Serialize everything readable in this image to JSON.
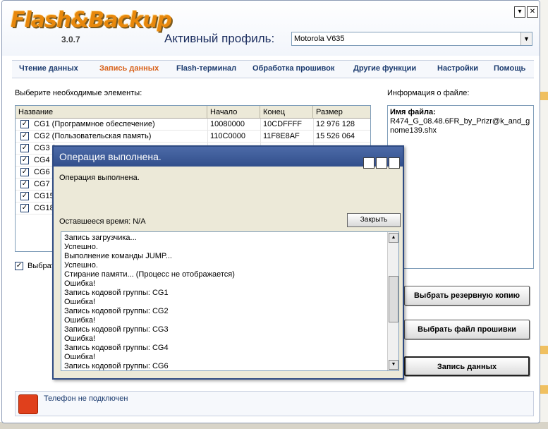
{
  "app": {
    "logo": "Flash&Backup",
    "version": "3.0.7",
    "profile_label": "Активный профиль:",
    "profile_value": "Motorola V635"
  },
  "tabs": [
    {
      "label": "Чтение данных"
    },
    {
      "label": "Запись данных"
    },
    {
      "label": "Flash-терминал"
    },
    {
      "label": "Обработка прошивок"
    },
    {
      "label": "Другие функции"
    },
    {
      "label": "Настройки"
    },
    {
      "label": "Помощь"
    }
  ],
  "select_label": "Выберите необходимые элементы:",
  "info_label": "Информация о файле:",
  "table": {
    "headers": [
      "Название",
      "Начало",
      "Конец",
      "Размер"
    ],
    "rows": [
      {
        "name": "CG1 (Программное обеспечение)",
        "start": "10080000",
        "end": "10CDFFFF",
        "size": "12 976 128"
      },
      {
        "name": "CG2 (Пользовательская память)",
        "start": "110C0000",
        "end": "11F8E8AF",
        "size": "15 526 064"
      },
      {
        "name": "CG3 (",
        "start": "",
        "end": "",
        "size": ""
      },
      {
        "name": "CG4 (",
        "start": "",
        "end": "",
        "size": ""
      },
      {
        "name": "CG6 (",
        "start": "",
        "end": "",
        "size": ""
      },
      {
        "name": "CG7 (",
        "start": "",
        "end": "",
        "size": ""
      },
      {
        "name": "CG15",
        "start": "",
        "end": "",
        "size": ""
      },
      {
        "name": "CG18",
        "start": "",
        "end": "",
        "size": ""
      }
    ]
  },
  "select_all": "Выбрат",
  "file_info": {
    "name_label": "Имя файла:",
    "name_value": "R474_G_08.48.6FR_by_Prizr@k_and_gnome139.shx"
  },
  "buttons": {
    "backup": "Выбрать резервную копию",
    "firmware": "Выбрать файл прошивки",
    "write": "Запись данных"
  },
  "status": {
    "text": "Телефон не подключен"
  },
  "dialog": {
    "title": "Операция выполнена.",
    "message": "Операция выполнена.",
    "time_left": "Оставшееся время: N/A",
    "close": "Закрыть",
    "log": [
      "Запись загрузчика...",
      "Успешно.",
      "Выполнение команды JUMP...",
      "Успешно.",
      "Стирание памяти... (Процесс не отображается)",
      "Ошибка!",
      "Запись кодовой группы: CG1",
      "Ошибка!",
      "Запись кодовой группы: CG2",
      "Ошибка!",
      "Запись кодовой группы: CG3",
      "Ошибка!",
      "Запись кодовой группы: CG4",
      "Ошибка!",
      "Запись кодовой группы: CG6"
    ]
  },
  "colors": {
    "accent": "#d86018",
    "tab_text": "#1a3a6e",
    "dialog_title": "#3a5896",
    "status_led": "#e0401c"
  }
}
